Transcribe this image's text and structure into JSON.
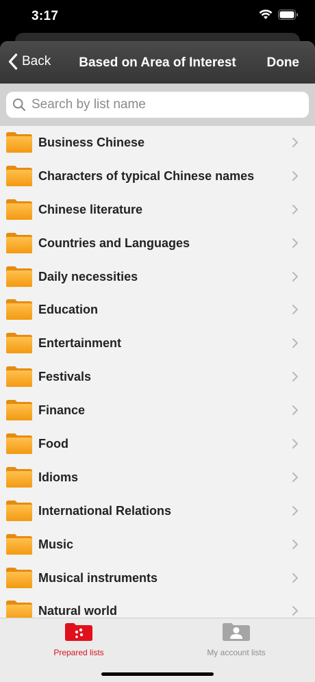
{
  "status_bar": {
    "time": "3:17"
  },
  "nav": {
    "back_label": "Back",
    "title": "Based on Area of Interest",
    "done_label": "Done"
  },
  "search": {
    "placeholder": "Search by list name",
    "value": ""
  },
  "list": {
    "items": [
      {
        "label": "Business Chinese"
      },
      {
        "label": "Characters of typical Chinese names"
      },
      {
        "label": "Chinese literature"
      },
      {
        "label": "Countries and Languages"
      },
      {
        "label": "Daily necessities"
      },
      {
        "label": "Education"
      },
      {
        "label": "Entertainment"
      },
      {
        "label": "Festivals"
      },
      {
        "label": "Finance"
      },
      {
        "label": "Food"
      },
      {
        "label": "Idioms"
      },
      {
        "label": "International Relations"
      },
      {
        "label": "Music"
      },
      {
        "label": "Musical instruments"
      },
      {
        "label": "Natural world"
      }
    ],
    "item_icon": "folder-icon",
    "trailing_icon": "chevron-right-icon"
  },
  "tab_bar": {
    "tabs": [
      {
        "label": "Prepared lists",
        "icon": "prepared-lists-icon",
        "selected": true
      },
      {
        "label": "My account lists",
        "icon": "account-lists-icon",
        "selected": false
      }
    ]
  },
  "colors": {
    "accent": "#d9141f",
    "nav_background": "#404040",
    "folder": "#f5a623"
  }
}
